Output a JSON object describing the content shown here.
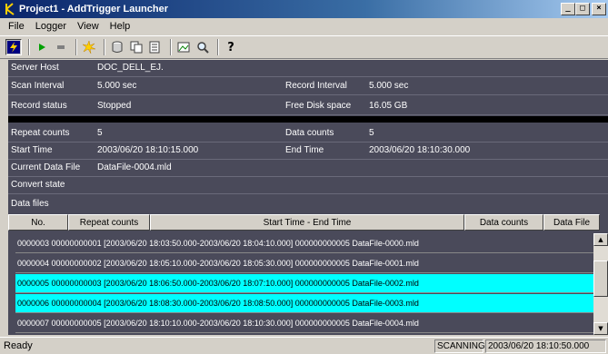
{
  "window": {
    "title": "Project1 - AddTrigger Launcher"
  },
  "menu": [
    "File",
    "Logger",
    "View",
    "Help"
  ],
  "toolbar": {
    "buttons": [
      "bolt-icon",
      "play-icon",
      "stop-icon",
      "burst-icon",
      "database-icon",
      "copy-icon",
      "list-icon",
      "image-icon",
      "zoom-icon",
      "help-icon"
    ],
    "help_label": "?"
  },
  "info": {
    "server_host_label": "Server Host",
    "server_host": "DOC_DELL_EJ.",
    "scan_interval_label": "Scan Interval",
    "scan_interval": "5.000 sec",
    "record_interval_label": "Record Interval",
    "record_interval": "5.000 sec",
    "record_status_label": "Record status",
    "record_status": "Stopped",
    "free_disk_label": "Free Disk space",
    "free_disk": "16.05 GB",
    "repeat_counts_label": "Repeat counts",
    "repeat_counts": "5",
    "data_counts_label": "Data counts",
    "data_counts": "5",
    "start_time_label": "Start Time",
    "start_time": "2003/06/20 18:10:15.000",
    "end_time_label": "End Time",
    "end_time": "2003/06/20 18:10:30.000",
    "current_file_label": "Current Data File",
    "current_file": "DataFile-0004.mld",
    "convert_state_label": "Convert state",
    "data_files_label": "Data files"
  },
  "table": {
    "headers": [
      "No.",
      "Repeat counts",
      "Start Time - End Time",
      "Data counts",
      "Data File"
    ],
    "rows": [
      "0000003 00000000001 [2003/06/20 18:03:50.000-2003/06/20 18:04:10.000] 000000000005  DataFile-0000.mld",
      "0000004 00000000002 [2003/06/20 18:05:10.000-2003/06/20 18:05:30.000] 000000000005  DataFile-0001.mld",
      "0000005 00000000003 [2003/06/20 18:06:50.000-2003/06/20 18:07:10.000] 000000000005  DataFile-0002.mld",
      "0000006 00000000004 [2003/06/20 18:08:30.000-2003/06/20 18:08:50.000] 000000000005  DataFile-0003.mld",
      "0000007 00000000005 [2003/06/20 18:10:10.000-2003/06/20 18:10:30.000] 000000000005  DataFile-0004.mld"
    ]
  },
  "status": {
    "text": "Ready",
    "mode": "SCANNING",
    "time": "2003/06/20 18:10:50.000"
  },
  "colors": {
    "panel": "#4a4a5a",
    "selection": "#00ffff",
    "title_start": "#0a246a"
  }
}
